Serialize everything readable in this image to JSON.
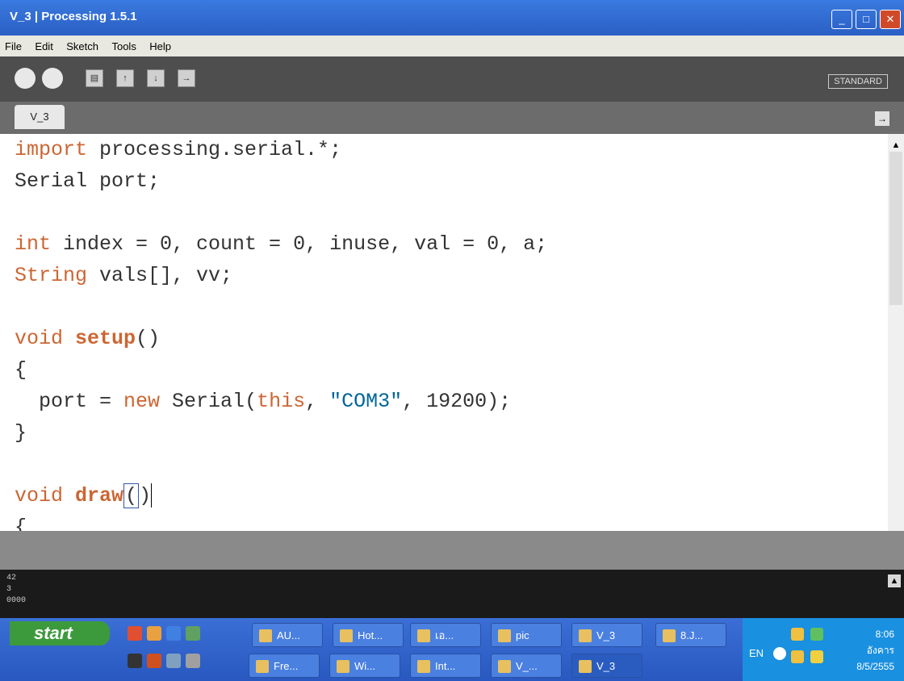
{
  "window": {
    "title": "V_3 | Processing 1.5.1",
    "minimize": "_",
    "maximize": "□",
    "close": "✕"
  },
  "menu": [
    "File",
    "Edit",
    "Sketch",
    "Tools",
    "Help"
  ],
  "toolbar": {
    "mode": "STANDARD"
  },
  "tab": {
    "label": "V_3",
    "arrow": "→"
  },
  "code_lines": [
    "import processing.serial.*;",
    "Serial port;",
    "",
    "int index = 0, count = 0, inuse, val = 0, a;",
    "String vals[], vv;",
    "",
    "void setup()",
    "{",
    "  port = new Serial(this, \"COM3\", 19200);",
    "}",
    "",
    "void draw()",
    "{"
  ],
  "console_lines": [
    "42",
    "3",
    "0000"
  ],
  "taskbar": {
    "start": "start",
    "row1": [
      "AU...",
      "Hot...",
      "เอ...",
      "pic",
      "V_3",
      "8.J..."
    ],
    "row2": [
      "Fre...",
      "Wi...",
      "Int...",
      "V_...",
      "V_3"
    ],
    "lang": "EN",
    "time": "8:06",
    "day": "อังคาร",
    "date": "8/5/2555"
  }
}
